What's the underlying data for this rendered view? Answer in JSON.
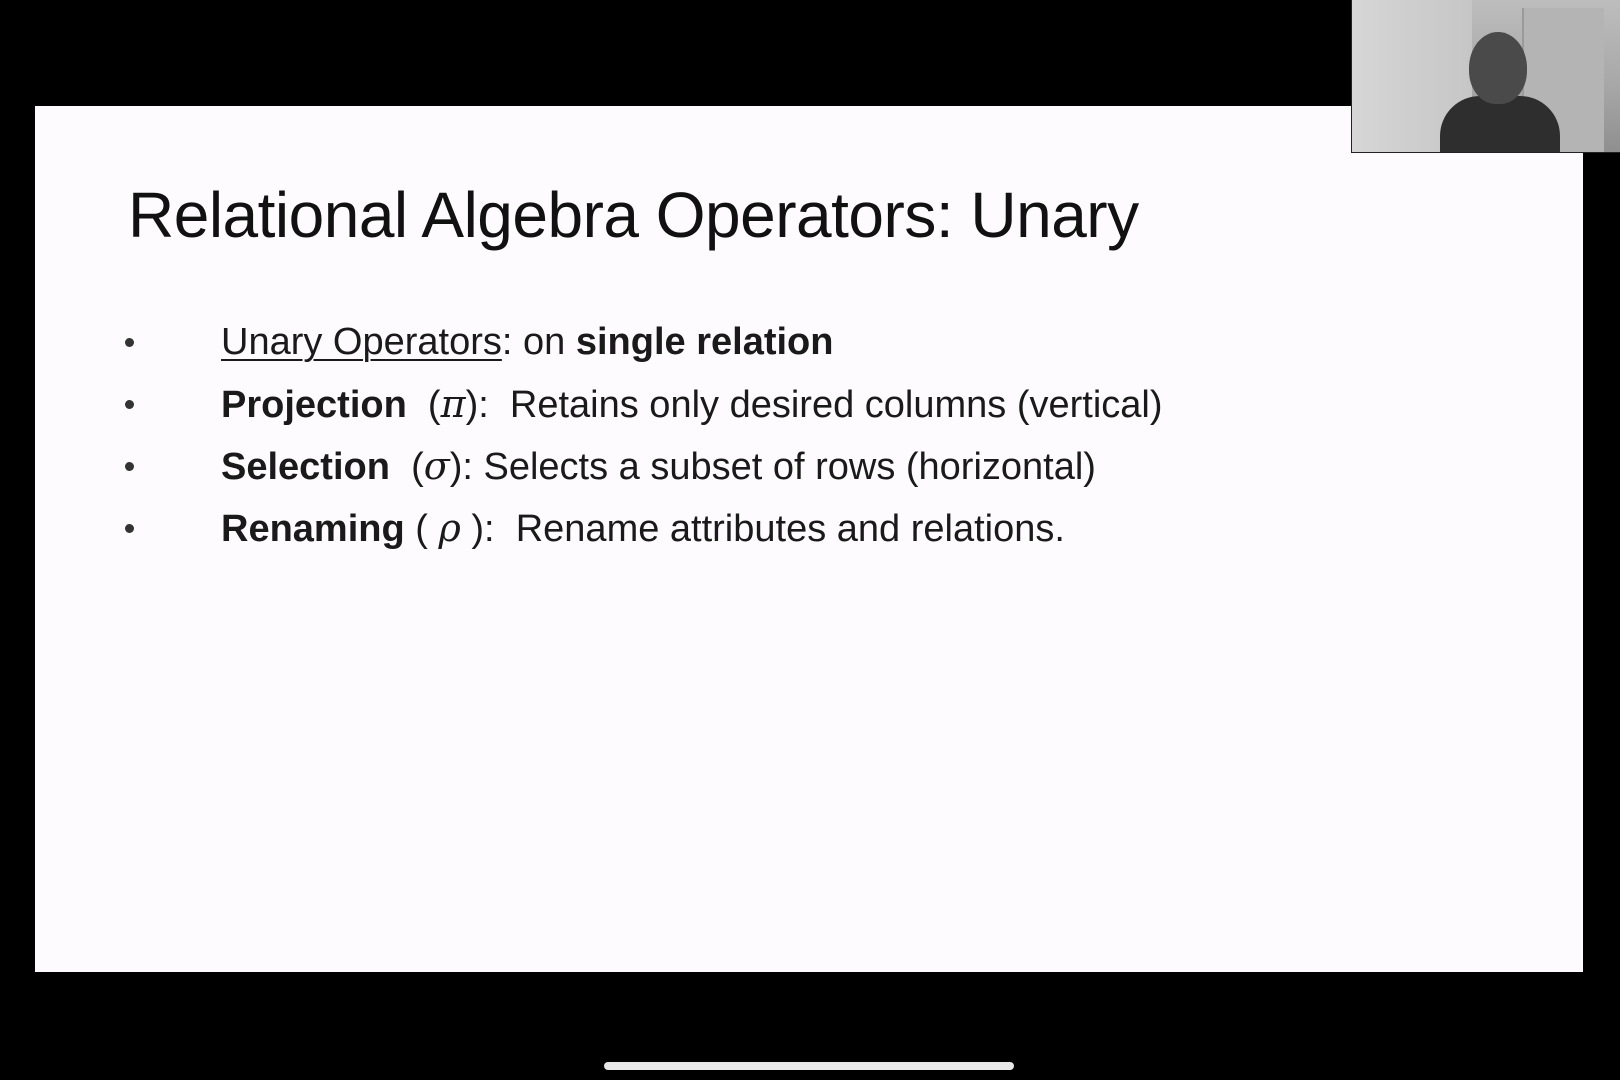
{
  "slide": {
    "title": "Relational Algebra Operators: Unary",
    "bullets": [
      {
        "term": "Unary Operators",
        "term_style": "underline",
        "symbol": "",
        "pre": "",
        "post": ": on ",
        "emphasis": "single relation",
        "tail": ""
      },
      {
        "term": "Projection",
        "term_style": "bold",
        "pre": "  (",
        "symbol": "π",
        "post": "):  ",
        "emphasis": "",
        "tail": "Retains only desired columns (vertical)"
      },
      {
        "term": "Selection",
        "term_style": "bold",
        "pre": "  (",
        "symbol": "σ",
        "post": "): ",
        "emphasis": "",
        "tail": "Selects a subset of rows (horizontal)"
      },
      {
        "term": "Renaming",
        "term_style": "bold",
        "pre": " ( ",
        "symbol": "ρ",
        "post": " ):  ",
        "emphasis": "",
        "tail": "Rename attributes and relations."
      }
    ]
  },
  "webcam": {
    "icon": "presenter-video-icon"
  },
  "colors": {
    "background": "#000000",
    "slide": "#fdfbfd",
    "text": "#1a1a1a",
    "home_indicator": "#e8e8e8"
  }
}
